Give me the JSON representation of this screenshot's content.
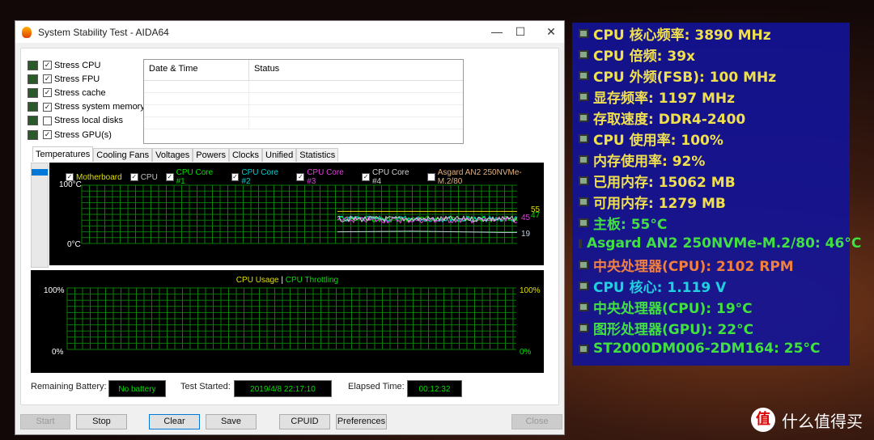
{
  "window": {
    "title": "System Stability Test - AIDA64",
    "minimize": "—",
    "maximize": "☐",
    "close": "✕"
  },
  "stress": [
    {
      "label": "Stress CPU",
      "checked": true
    },
    {
      "label": "Stress FPU",
      "checked": true
    },
    {
      "label": "Stress cache",
      "checked": true
    },
    {
      "label": "Stress system memory",
      "checked": true
    },
    {
      "label": "Stress local disks",
      "checked": false
    },
    {
      "label": "Stress GPU(s)",
      "checked": true
    }
  ],
  "log": {
    "col_datetime": "Date & Time",
    "col_status": "Status"
  },
  "tabs": [
    "Temperatures",
    "Cooling Fans",
    "Voltages",
    "Powers",
    "Clocks",
    "Unified",
    "Statistics"
  ],
  "temp_chart": {
    "legend": [
      {
        "label": "Motherboard",
        "color": "#e0e000",
        "checked": true
      },
      {
        "label": "CPU",
        "color": "#c0c0c0",
        "checked": true
      },
      {
        "label": "CPU Core #1",
        "color": "#00e000",
        "checked": true
      },
      {
        "label": "CPU Core #2",
        "color": "#00d0d0",
        "checked": true
      },
      {
        "label": "CPU Core #3",
        "color": "#e040e0",
        "checked": true
      },
      {
        "label": "CPU Core #4",
        "color": "#d0d0d0",
        "checked": true
      },
      {
        "label": "Asgard AN2 250NVMe-M.2/80",
        "color": "#e0b080",
        "checked": false
      }
    ],
    "y_max": "100°C",
    "y_min": "0°C",
    "current_labels": {
      "motherboard": "55",
      "core": "47",
      "core3": "45",
      "cpu": "19"
    }
  },
  "usage_chart": {
    "title_usage": "CPU Usage",
    "sep": "|",
    "title_throttle": "CPU Throttling",
    "left_max": "100%",
    "left_min": "0%",
    "right_max": "100%",
    "right_min": "0%",
    "usage_color": "#e0e000",
    "throttle_color": "#00e000"
  },
  "status": {
    "battery_label": "Remaining Battery:",
    "battery_value": "No battery",
    "started_label": "Test Started:",
    "started_value": "2019/4/8 22:17:10",
    "elapsed_label": "Elapsed Time:",
    "elapsed_value": "00:12:32"
  },
  "buttons": {
    "start": "Start",
    "stop": "Stop",
    "clear": "Clear",
    "save": "Save",
    "cpuid": "CPUID",
    "preferences": "Preferences",
    "close": "Close"
  },
  "osd": [
    {
      "text": "CPU 核心频率: 3890 MHz",
      "color": "#f0e050",
      "icon": "cpu-icon"
    },
    {
      "text": "CPU 倍频: 39x",
      "color": "#f0e050",
      "icon": "cpu-icon"
    },
    {
      "text": "CPU 外频(FSB): 100 MHz",
      "color": "#f0e050",
      "icon": "cpu-icon"
    },
    {
      "text": "显存频率: 1197 MHz",
      "color": "#f0e050",
      "icon": "memory-icon"
    },
    {
      "text": "存取速度: DDR4-2400",
      "color": "#f0e050",
      "icon": "memory-icon"
    },
    {
      "text": "CPU 使用率: 100%",
      "color": "#f0e050",
      "icon": "hourglass-icon"
    },
    {
      "text": "内存使用率: 92%",
      "color": "#f0e050",
      "icon": "memory-icon"
    },
    {
      "text": "已用内存: 15062 MB",
      "color": "#f0e050",
      "icon": "memory-icon"
    },
    {
      "text": "可用内存: 1279 MB",
      "color": "#f0e050",
      "icon": "memory-icon"
    },
    {
      "text": "主板: 55°C",
      "color": "#40e040",
      "icon": "motherboard-icon"
    },
    {
      "text": "Asgard AN2 250NVMe-M.2/80: 46°C",
      "color": "#40e040",
      "icon": "disk-icon"
    },
    {
      "text": "中央处理器(CPU): 2102 RPM",
      "color": "#f08040",
      "icon": "cpu-icon"
    },
    {
      "text": "CPU 核心: 1.119 V",
      "color": "#20d0e0",
      "icon": "cpu-icon"
    },
    {
      "text": "中央处理器(CPU): 19°C",
      "color": "#40e040",
      "icon": "cpu-icon"
    },
    {
      "text": "图形处理器(GPU): 22°C",
      "color": "#40e040",
      "icon": "gpu-icon"
    },
    {
      "text": "ST2000DM006-2DM164: 25°C",
      "color": "#40e040",
      "icon": "disk-icon"
    }
  ],
  "watermark": {
    "logo": "值",
    "text": "什么值得买"
  }
}
